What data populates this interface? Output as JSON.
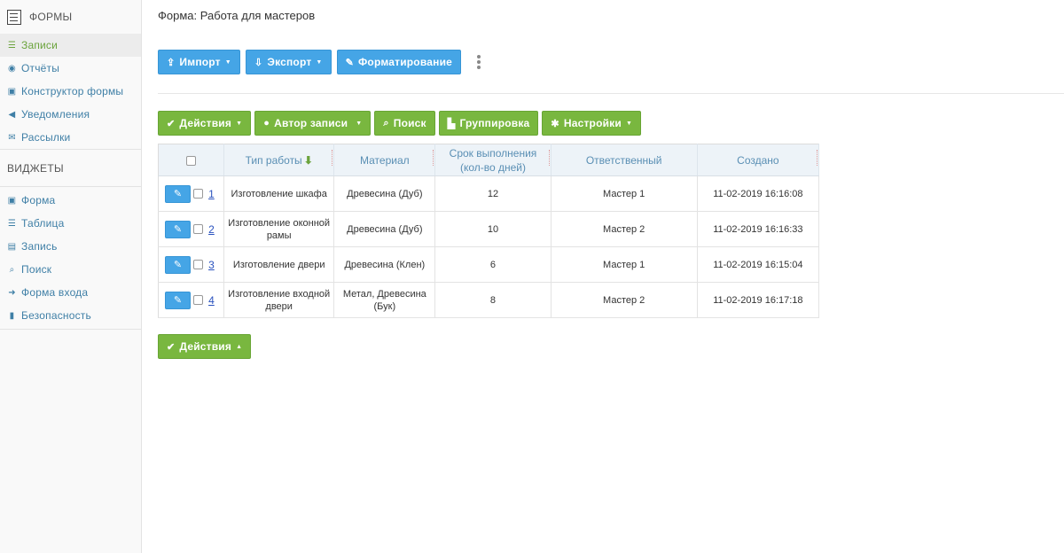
{
  "sidebar": {
    "header": "ФОРМЫ",
    "items": [
      {
        "label": "Записи",
        "icon": "list-icon",
        "active": true
      },
      {
        "label": "Отчёты",
        "icon": "circle-arrow-icon"
      },
      {
        "label": "Конструктор формы",
        "icon": "form-icon"
      },
      {
        "label": "Уведомления",
        "icon": "megaphone-icon"
      },
      {
        "label": "Рассылки",
        "icon": "envelope-icon"
      }
    ],
    "widgets_header": "ВИДЖЕТЫ",
    "widgets": [
      {
        "label": "Форма",
        "icon": "form-icon"
      },
      {
        "label": "Таблица",
        "icon": "list-icon"
      },
      {
        "label": "Запись",
        "icon": "document-icon"
      },
      {
        "label": "Поиск",
        "icon": "search-icon"
      },
      {
        "label": "Форма входа",
        "icon": "sign-in-icon"
      },
      {
        "label": "Безопасность",
        "icon": "lock-icon"
      }
    ]
  },
  "main": {
    "title": "Форма: Работа для мастеров",
    "toolbar": {
      "import": "Импорт",
      "export": "Экспорт",
      "format": "Форматирование"
    },
    "actions": {
      "actions": "Действия",
      "author": "Автор записи",
      "search": "Поиск",
      "grouping": "Группировка",
      "settings": "Настройки"
    },
    "table": {
      "headers": {
        "type": "Тип работы",
        "material": "Материал",
        "deadline_l1": "Срок выполнения",
        "deadline_l2": "(кол-во дней)",
        "responsible": "Ответственный",
        "created": "Создано"
      },
      "rows": [
        {
          "id": "1",
          "type": "Изготовление шкафа",
          "material": "Древесина (Дуб)",
          "days": "12",
          "responsible": "Мастер 1",
          "created": "11-02-2019 16:16:08"
        },
        {
          "id": "2",
          "type": "Изготовление оконной рамы",
          "material": "Древесина (Дуб)",
          "days": "10",
          "responsible": "Мастер 2",
          "created": "11-02-2019 16:16:33"
        },
        {
          "id": "3",
          "type": "Изготовление двери",
          "material": "Древесина (Клен)",
          "days": "6",
          "responsible": "Мастер 1",
          "created": "11-02-2019 16:15:04"
        },
        {
          "id": "4",
          "type": "Изготовление входной двери",
          "material": "Метал, Древесина (Бук)",
          "days": "8",
          "responsible": "Мастер 2",
          "created": "11-02-2019 16:17:18"
        }
      ]
    },
    "bottom_actions": "Действия"
  },
  "colors": {
    "blue_button": "#45a5e6",
    "green_button": "#79b73f",
    "link": "#3f7fa6",
    "active": "#6ba33c"
  }
}
